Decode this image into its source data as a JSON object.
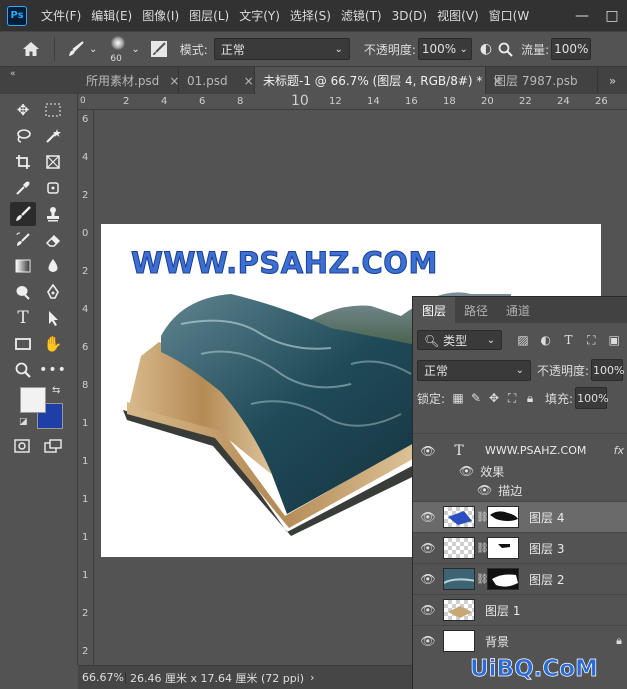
{
  "app": {
    "logo": "Ps",
    "menu": [
      "文件(F)",
      "编辑(E)",
      "图像(I)",
      "图层(L)",
      "文字(Y)",
      "选择(S)",
      "滤镜(T)",
      "3D(D)",
      "视图(V)",
      "窗口(W"
    ],
    "window_buttons": [
      "—",
      "□"
    ]
  },
  "options": {
    "brush_size": "60",
    "mode_label": "模式:",
    "mode_value": "正常",
    "opacity_label": "不透明度:",
    "opacity_value": "100%",
    "flow_label": "流量:",
    "flow_value": "100%"
  },
  "tabs": [
    {
      "label": "所用素材.psd",
      "active": false
    },
    {
      "label": "01.psd",
      "active": false
    },
    {
      "label": "未标题-1 @ 66.7% (图层 4, RGB/8#) *",
      "active": true
    },
    {
      "label": "图层 7987.psb",
      "active": false
    }
  ],
  "tabs_overflow": "»",
  "toolbar_collapse": "«",
  "ruler": {
    "h_ticks": [
      "0",
      "2",
      "4",
      "6",
      "8",
      "10",
      "12",
      "14",
      "16",
      "18",
      "20",
      "22",
      "24",
      "26"
    ],
    "v_ticks": [
      "6",
      "4",
      "2",
      "0",
      "2",
      "4",
      "6",
      "8",
      "1",
      "1",
      "1",
      "1",
      "1",
      "2",
      "2"
    ]
  },
  "canvas": {
    "title_text": "WWW.PSAHZ.COM"
  },
  "status": {
    "zoom": "66.67%",
    "doc_info": "26.46 厘米 x 17.64 厘米 (72 ppi)",
    "arrow": "›"
  },
  "layers_panel": {
    "tabs": [
      "图层",
      "路径",
      "通道"
    ],
    "filter_value": "类型",
    "blend_value": "正常",
    "opacity_label": "不透明度:",
    "opacity_value": "100%",
    "lock_label": "锁定:",
    "fill_label": "填充:",
    "fill_value": "100%",
    "text_layer": {
      "name": "WWW.PSAHZ.COM",
      "fx": "fx",
      "effects_label": "效果",
      "stroke_label": "描边"
    },
    "layers": [
      {
        "name": "图层 4",
        "selected": true
      },
      {
        "name": "图层 3",
        "selected": false
      },
      {
        "name": "图层 2",
        "selected": false
      },
      {
        "name": "图层 1",
        "selected": false
      },
      {
        "name": "背景",
        "selected": false
      }
    ]
  },
  "watermark": "UiBQ.CoM",
  "colors": {
    "foreground": "#f2f2f2",
    "background": "#1e3fa6",
    "app_bg": "#535353",
    "menubar": "#323232"
  }
}
